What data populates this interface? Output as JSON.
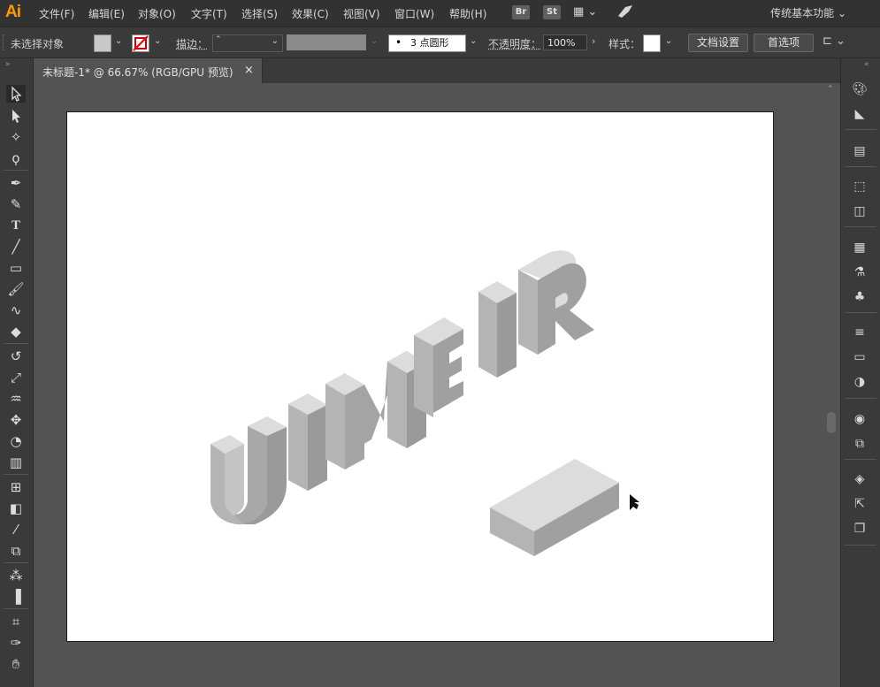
{
  "app": {
    "logo": "Ai"
  },
  "menu": {
    "items": [
      "文件(F)",
      "编辑(E)",
      "对象(O)",
      "文字(T)",
      "选择(S)",
      "效果(C)",
      "视图(V)",
      "窗口(W)",
      "帮助(H)"
    ],
    "bridge": "Br",
    "stock": "St",
    "workspace": "传统基本功能"
  },
  "control": {
    "selection_status": "未选择对象",
    "stroke_label": "描边：",
    "brush_label": "3 点圆形",
    "opacity_label": "不透明度：",
    "opacity_value": "100%",
    "style_label": "样式：",
    "doc_setup": "文档设置",
    "preferences": "首选项"
  },
  "document": {
    "tab_title": "未标题-1* @ 66.67% (RGB/GPU 预览)",
    "close_glyph": "×"
  },
  "artwork": {
    "text": "UIMEIR",
    "colors": {
      "top": "#dcdcdc",
      "left": "#b4b4b4",
      "right": "#a0a0a0"
    }
  },
  "icons": {
    "left_tools": [
      "selection-tool-icon",
      "direct-selection-tool-icon",
      "magic-wand-icon",
      "lasso-icon",
      "pen-icon",
      "curvature-icon",
      "type-icon",
      "line-icon",
      "rectangle-icon",
      "paintbrush-icon",
      "shaper-icon",
      "eraser-icon",
      "rotate-icon",
      "scale-icon",
      "warp-icon",
      "free-transform-icon",
      "shape-builder-icon",
      "perspective-grid-icon",
      "mesh-icon",
      "gradient-icon",
      "eyedropper-icon",
      "blend-icon",
      "symbol-sprayer-icon",
      "column-graph-icon",
      "artboard-icon",
      "slice-icon",
      "hand-icon"
    ],
    "right_panels": [
      "color-icon",
      "color-guide-icon",
      "align-icon",
      "transform-icon",
      "pathfinder-icon",
      "swatches-icon",
      "brushes-icon",
      "symbols-icon",
      "stroke-icon",
      "gradient-panel-icon",
      "transparency-icon",
      "appearance-icon",
      "graphic-styles-icon",
      "layers-icon",
      "export-icon",
      "artboards-icon"
    ]
  }
}
